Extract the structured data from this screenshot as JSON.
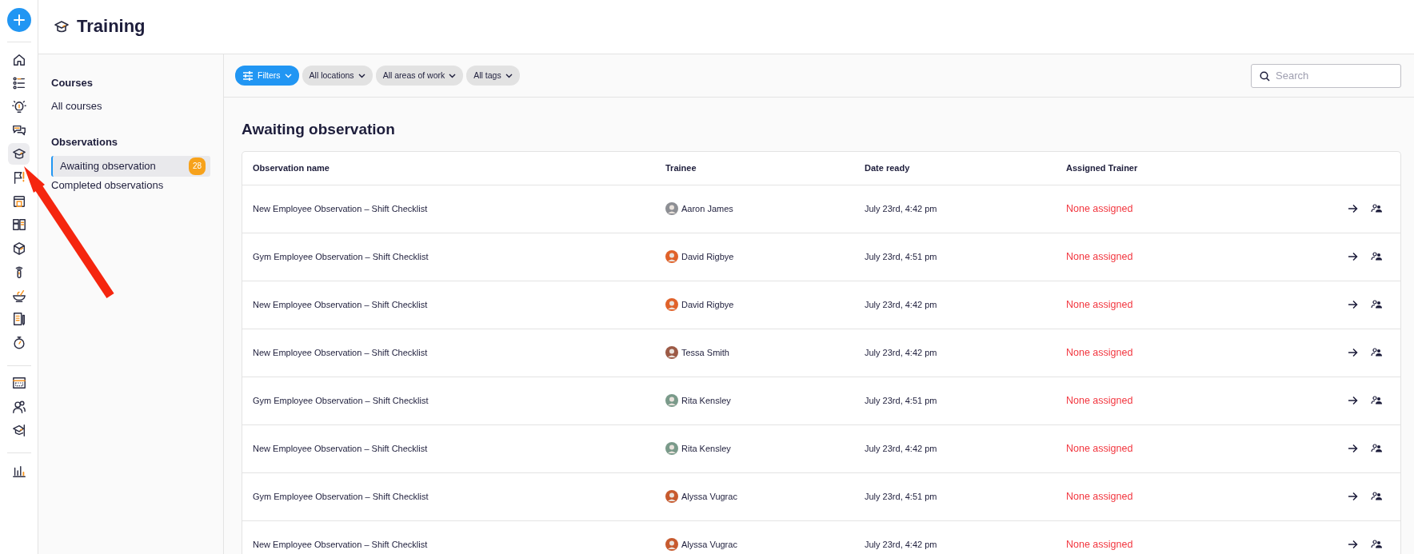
{
  "rail": {
    "groups": [
      [
        {
          "selected": false
        },
        {
          "selected": false
        },
        {
          "selected": false
        },
        {
          "selected": false
        },
        {
          "selected": true
        },
        {
          "selected": false
        },
        {
          "selected": false
        },
        {
          "selected": false
        },
        {
          "selected": false
        },
        {
          "selected": false
        },
        {
          "selected": false
        },
        {
          "selected": false
        },
        {
          "selected": false
        }
      ],
      [
        {
          "selected": false
        },
        {
          "selected": false
        },
        {
          "selected": false
        }
      ],
      [
        {
          "selected": false
        }
      ]
    ]
  },
  "header": {
    "title": "Training"
  },
  "sidebar": {
    "sections": [
      {
        "heading": "Courses",
        "items": [
          {
            "label": "All courses",
            "selected": false
          }
        ]
      },
      {
        "heading": "Observations",
        "items": [
          {
            "label": "Awaiting observation",
            "selected": true,
            "badge": "28"
          },
          {
            "label": "Completed observations",
            "selected": false
          }
        ]
      }
    ]
  },
  "filters": [
    {
      "label": "Filters",
      "kind": "primary"
    },
    {
      "label": "All locations",
      "kind": "dropdown"
    },
    {
      "label": "All areas of work",
      "kind": "dropdown"
    },
    {
      "label": "All tags",
      "kind": "dropdown"
    }
  ],
  "search": {
    "placeholder": "Search"
  },
  "section_title": "Awaiting observation",
  "table": {
    "columns": [
      "Observation name",
      "Trainee",
      "Date ready",
      "Assigned Trainer"
    ],
    "rows": [
      {
        "name": "New Employee Observation – Shift Checklist",
        "trainee": "Aaron James",
        "date_ready": "July 23rd, 4:42 pm",
        "trainer": "None assigned",
        "trainer_assigned": false
      },
      {
        "name": "Gym Employee Observation – Shift Checklist",
        "trainee": "David Rigbye",
        "date_ready": "July 23rd, 4:51 pm",
        "trainer": "None assigned",
        "trainer_assigned": false
      },
      {
        "name": "New Employee Observation – Shift Checklist",
        "trainee": "David Rigbye",
        "date_ready": "July 23rd, 4:42 pm",
        "trainer": "None assigned",
        "trainer_assigned": false
      },
      {
        "name": "New Employee Observation – Shift Checklist",
        "trainee": "Tessa Smith",
        "date_ready": "July 23rd, 4:42 pm",
        "trainer": "None assigned",
        "trainer_assigned": false
      },
      {
        "name": "Gym Employee Observation – Shift Checklist",
        "trainee": "Rita Kensley",
        "date_ready": "July 23rd, 4:51 pm",
        "trainer": "None assigned",
        "trainer_assigned": false
      },
      {
        "name": "New Employee Observation – Shift Checklist",
        "trainee": "Rita Kensley",
        "date_ready": "July 23rd, 4:42 pm",
        "trainer": "None assigned",
        "trainer_assigned": false
      },
      {
        "name": "Gym Employee Observation – Shift Checklist",
        "trainee": "Alyssa Vugrac",
        "date_ready": "July 23rd, 4:51 pm",
        "trainer": "None assigned",
        "trainer_assigned": false
      },
      {
        "name": "New Employee Observation – Shift Checklist",
        "trainee": "Alyssa Vugrac",
        "date_ready": "July 23rd, 4:42 pm",
        "trainer": "None assigned",
        "trainer_assigned": false
      }
    ]
  }
}
